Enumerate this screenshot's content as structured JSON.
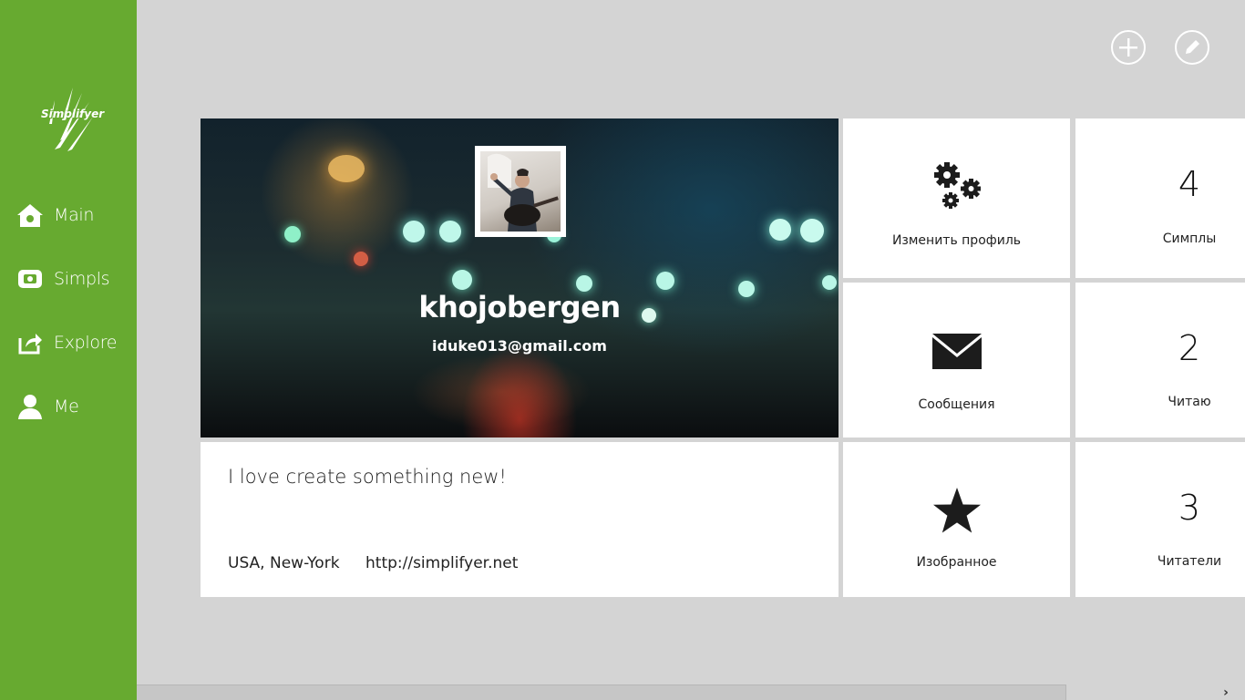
{
  "app": {
    "logo_text": "Simplifyer"
  },
  "sidebar": {
    "items": [
      {
        "label": "Main",
        "icon": "home-icon"
      },
      {
        "label": "Simpls",
        "icon": "simpls-icon"
      },
      {
        "label": "Explore",
        "icon": "share-icon"
      },
      {
        "label": "Me",
        "icon": "person-icon"
      }
    ]
  },
  "toolbar": {
    "add_icon": "plus-circle-icon",
    "edit_icon": "pencil-circle-icon"
  },
  "profile": {
    "username": "khojobergen",
    "email": "iduke013@gmail.com",
    "bio": "I love create something new!",
    "location": "USA, New-York",
    "website": "http://simplifyer.net"
  },
  "tiles": {
    "edit_profile": {
      "label": "Изменить профиль",
      "icon": "gears-icon"
    },
    "messages": {
      "label": "Сообщения",
      "icon": "envelope-icon"
    },
    "favorites": {
      "label": "Изобранное",
      "icon": "star-icon"
    }
  },
  "stats": [
    {
      "value": "4",
      "label": "Симплы"
    },
    {
      "value": "2",
      "label": "Читаю"
    },
    {
      "value": "3",
      "label": "Читатели"
    }
  ],
  "colors": {
    "sidebar": "#67aa30",
    "background": "#d4d4d4",
    "tile": "#ffffff"
  },
  "scroll": {
    "arrow": "›"
  }
}
